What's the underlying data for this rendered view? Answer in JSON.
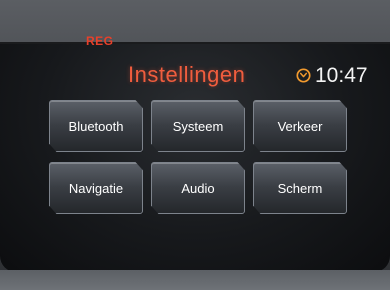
{
  "status": {
    "indicator": "REG"
  },
  "header": {
    "title": "Instellingen",
    "time": "10:47"
  },
  "menu": {
    "buttons": [
      {
        "label": "Bluetooth"
      },
      {
        "label": "Systeem"
      },
      {
        "label": "Verkeer"
      },
      {
        "label": "Navigatie"
      },
      {
        "label": "Audio"
      },
      {
        "label": "Scherm"
      }
    ]
  },
  "colors": {
    "title": "#f05d3e",
    "indicator": "#e8402a",
    "clock_icon": "#f29a2e",
    "button_text": "#ffffff"
  },
  "icons": {
    "clock": "clock-icon"
  }
}
